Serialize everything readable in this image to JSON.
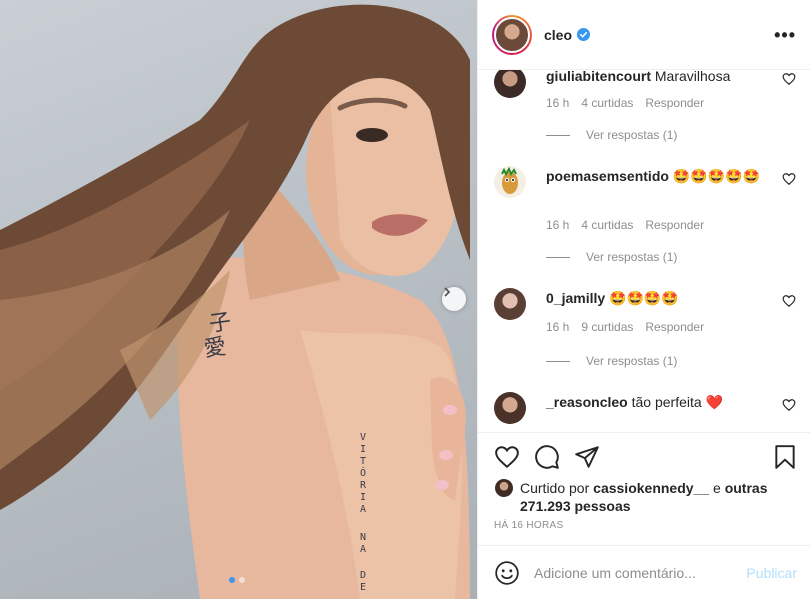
{
  "post": {
    "username": "cleo",
    "verified": true,
    "more_label": "•••"
  },
  "photo": {
    "carousel_count": 2,
    "active_index": 0
  },
  "comments": [
    {
      "username": "giuliabitencourt",
      "text": "Maravilhosa",
      "time": "16 h",
      "likes": "4 curtidas",
      "reply": "Responder",
      "view_replies": "Ver respostas (1)"
    },
    {
      "username": "poemasemsentido",
      "text": "🤩🤩🤩🤩🤩",
      "time": "16 h",
      "likes": "4 curtidas",
      "reply": "Responder",
      "view_replies": "Ver respostas (1)"
    },
    {
      "username": "0_jamilly",
      "text": "🤩🤩🤩🤩",
      "time": "16 h",
      "likes": "9 curtidas",
      "reply": "Responder",
      "view_replies": "Ver respostas (1)"
    },
    {
      "username": "_reasoncleo",
      "text": "tão perfeita ❤️",
      "time": "",
      "likes": "",
      "reply": "",
      "view_replies": ""
    }
  ],
  "likes_summary": {
    "prefix": "Curtido por",
    "user": "cassiokennedy__",
    "conj": "e",
    "others": "outras 271.293 pessoas"
  },
  "time_ago": "HÁ 16 HORAS",
  "add_comment": {
    "placeholder": "Adicione um comentário...",
    "publish_label": "Publicar"
  },
  "colors": {
    "accent": "#3897f0",
    "publish_disabled": "#b2dffc",
    "meta_text": "#8e8e8e",
    "heart_red": "#ed4956"
  }
}
